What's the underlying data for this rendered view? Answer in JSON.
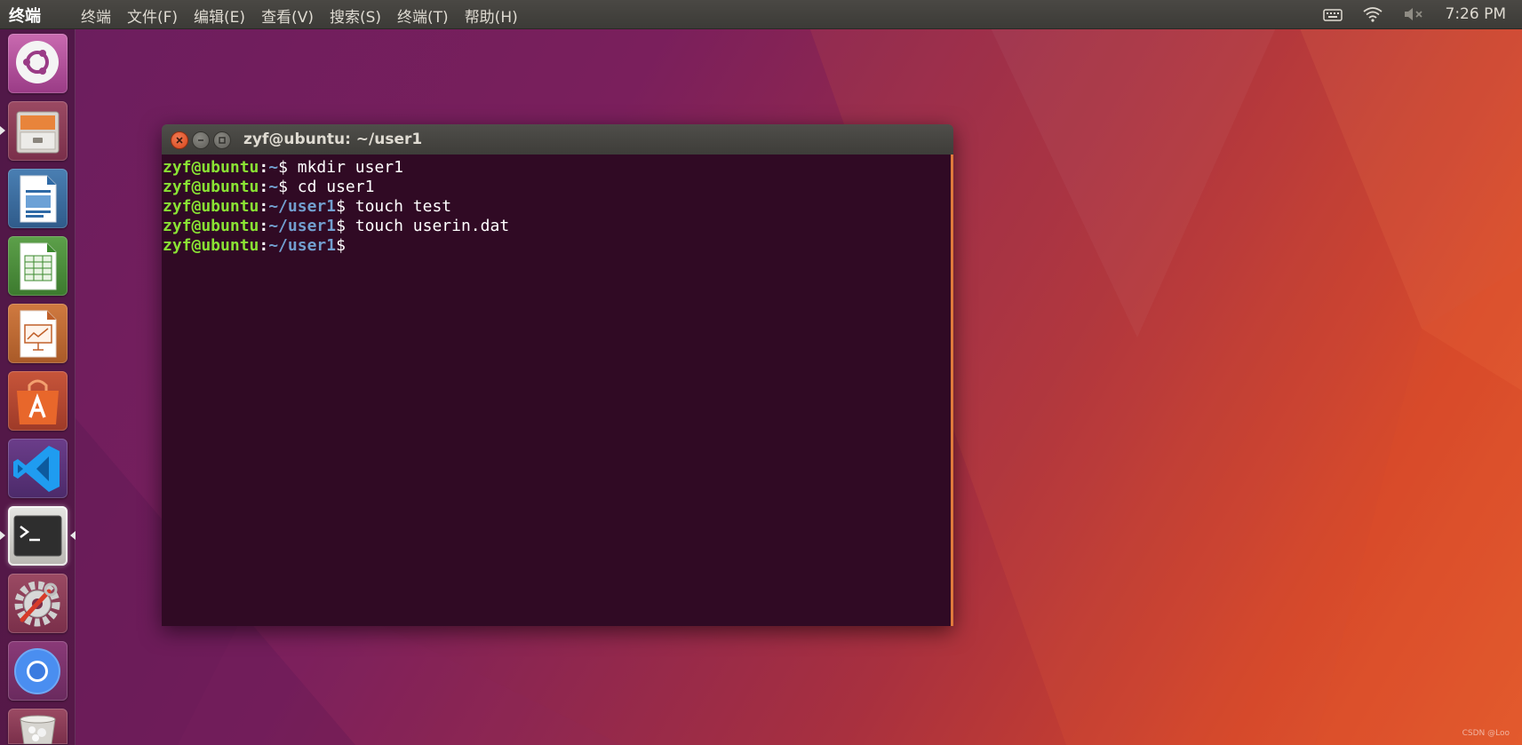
{
  "top_panel": {
    "app_title": "终端",
    "menus": [
      "终端",
      "文件(F)",
      "编辑(E)",
      "查看(V)",
      "搜索(S)",
      "终端(T)",
      "帮助(H)"
    ],
    "clock": "7:26 PM",
    "tray_icons": [
      "keyboard-icon",
      "wifi-icon",
      "volume-muted-icon"
    ]
  },
  "launcher": {
    "items": [
      {
        "name": "ubuntu-dash-icon"
      },
      {
        "name": "files-icon"
      },
      {
        "name": "libreoffice-writer-icon"
      },
      {
        "name": "libreoffice-calc-icon"
      },
      {
        "name": "libreoffice-impress-icon"
      },
      {
        "name": "software-center-icon"
      },
      {
        "name": "vscode-icon"
      },
      {
        "name": "terminal-icon"
      },
      {
        "name": "system-settings-icon"
      },
      {
        "name": "chromium-icon"
      },
      {
        "name": "trash-icon"
      }
    ]
  },
  "terminal": {
    "window_title": "zyf@ubuntu: ~/user1",
    "lines": [
      {
        "user": "zyf@ubuntu",
        "path": "~",
        "command": " mkdir user1"
      },
      {
        "user": "zyf@ubuntu",
        "path": "~",
        "command": " cd user1"
      },
      {
        "user": "zyf@ubuntu",
        "path": "~/user1",
        "command": " touch test"
      },
      {
        "user": "zyf@ubuntu",
        "path": "~/user1",
        "command": " touch userin.dat"
      },
      {
        "user": "zyf@ubuntu",
        "path": "~/user1",
        "command": ""
      }
    ]
  },
  "watermark": "CSDN @Loo",
  "colors": {
    "terminal_bg": "#300a24",
    "prompt_user": "#8ae234",
    "prompt_path": "#729fcf",
    "panel_bg": "#3c3b37"
  }
}
